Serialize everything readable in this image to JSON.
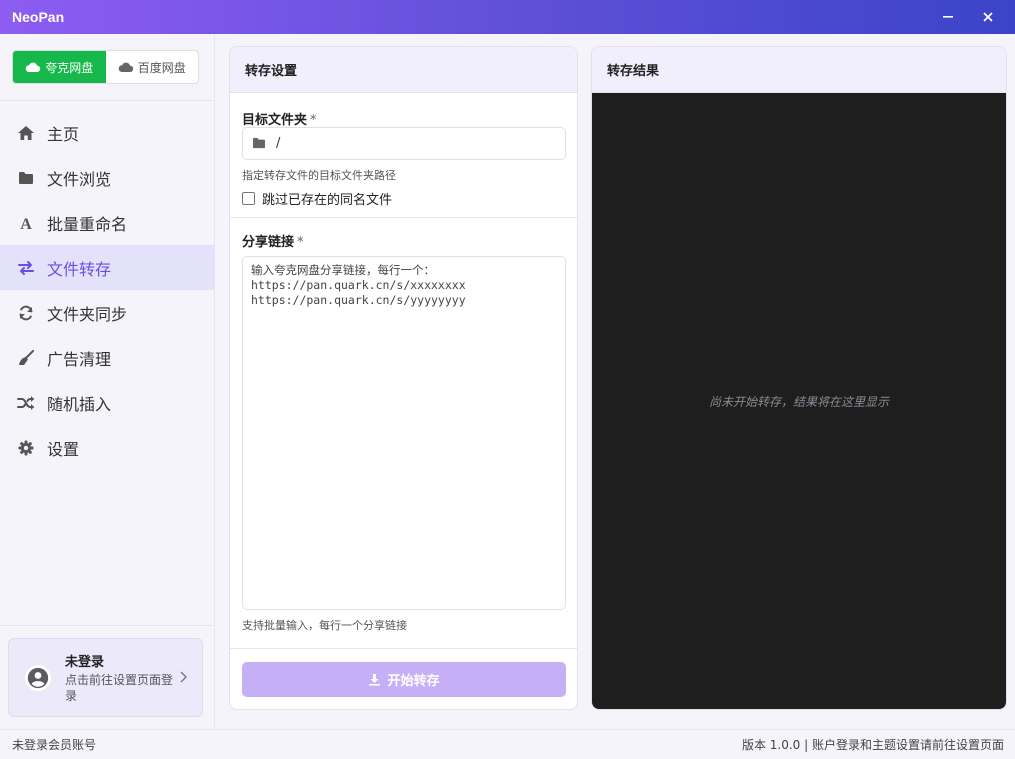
{
  "window": {
    "title": "NeoPan"
  },
  "sidebar": {
    "drives": [
      {
        "label": "夸克网盘",
        "icon": "cloud-icon",
        "active": true
      },
      {
        "label": "百度网盘",
        "icon": "cloud-icon",
        "active": false
      }
    ],
    "nav": [
      {
        "label": "主页",
        "icon": "home-icon"
      },
      {
        "label": "文件浏览",
        "icon": "folder-icon"
      },
      {
        "label": "批量重命名",
        "icon": "font-icon"
      },
      {
        "label": "文件转存",
        "icon": "transfer-icon",
        "active": true
      },
      {
        "label": "文件夹同步",
        "icon": "sync-icon"
      },
      {
        "label": "广告清理",
        "icon": "broom-icon"
      },
      {
        "label": "随机插入",
        "icon": "shuffle-icon"
      },
      {
        "label": "设置",
        "icon": "gear-icon"
      }
    ],
    "user": {
      "name": "未登录",
      "hint": "点击前往设置页面登录"
    }
  },
  "transfer": {
    "title": "转存设置",
    "target_label": "目标文件夹",
    "required_mark": "*",
    "target_value": "/",
    "target_help": "指定转存文件的目标文件夹路径",
    "skip_label": "跳过已存在的同名文件",
    "skip_checked": false,
    "share_label": "分享链接",
    "share_placeholder_lines": [
      "输入夸克网盘分享链接，每行一个：",
      "https://pan.quark.cn/s/xxxxxxxx",
      "https://pan.quark.cn/s/yyyyyyyy"
    ],
    "share_help": "支持批量输入，每行一个分享链接",
    "start_label": "开始转存"
  },
  "result": {
    "title": "转存结果",
    "empty": "尚未开始转存，结果将在这里显示"
  },
  "status": {
    "left": "未登录会员账号",
    "right": "版本 1.0.0 | 账户登录和主题设置请前往设置页面"
  },
  "colors": {
    "accent": "#6a4ee8",
    "drive_active": "#16b84b",
    "start_button": "#c5b0f7",
    "result_bg": "#1e1e1e"
  }
}
